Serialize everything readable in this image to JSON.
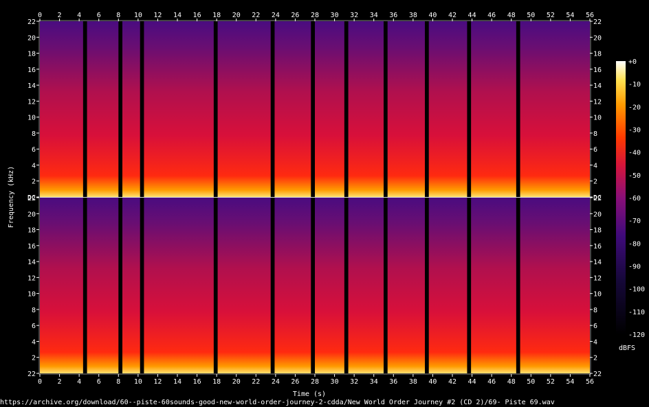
{
  "chart_data": {
    "type": "heatmap",
    "title": "",
    "xlabel": "Time (s)",
    "ylabel": "Frequency (kHz)",
    "footer": "https://archive.org/download/60--piste-60sounds-good-new-world-order-journey-2-cdda/New World Order Journey #2 (CD 2)/69- Piste 69.wav",
    "xlim": [
      0,
      56
    ],
    "x_ticks": [
      "0",
      "2",
      "4",
      "6",
      "8",
      "10",
      "12",
      "14",
      "16",
      "18",
      "20",
      "22",
      "24",
      "26",
      "28",
      "30",
      "32",
      "34",
      "36",
      "38",
      "40",
      "42",
      "44",
      "46",
      "48",
      "50",
      "52",
      "54",
      "56"
    ],
    "channels": [
      {
        "ylim": [
          0,
          22
        ],
        "y_ticks": [
          "DC",
          "2",
          "4",
          "6",
          "8",
          "10",
          "12",
          "14",
          "16",
          "18",
          "20",
          "22"
        ]
      },
      {
        "ylim": [
          0,
          22
        ],
        "y_ticks": [
          "22",
          "2",
          "4",
          "6",
          "8",
          "10",
          "12",
          "14",
          "16",
          "18",
          "20",
          "22"
        ]
      }
    ],
    "colorbar": {
      "label": "dBFS",
      "range": [
        -120,
        0
      ],
      "ticks": [
        "+0",
        "-10",
        "-20",
        "-30",
        "-40",
        "-50",
        "-60",
        "-70",
        "-80",
        "-90",
        "-100",
        "-110",
        "-120"
      ]
    },
    "silent_gaps_s": [
      [
        4.4,
        4.8
      ],
      [
        8.0,
        8.4
      ],
      [
        10.2,
        10.6
      ],
      [
        17.7,
        18.1
      ],
      [
        23.5,
        23.9
      ],
      [
        27.6,
        28.0
      ],
      [
        31.0,
        31.4
      ],
      [
        35.0,
        35.4
      ],
      [
        39.2,
        39.6
      ],
      [
        43.5,
        43.9
      ],
      [
        48.5,
        48.9
      ]
    ]
  }
}
